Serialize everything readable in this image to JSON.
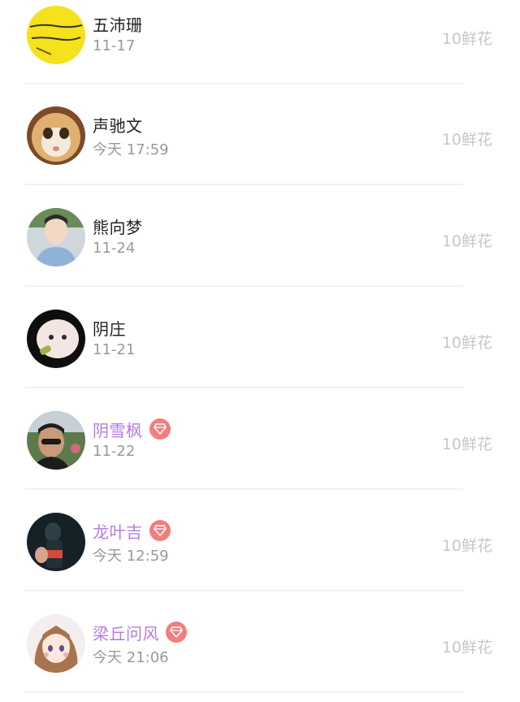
{
  "gift_rows": [
    {
      "name": "五沛珊",
      "time": "11-17",
      "gift": "10鲜花",
      "vip": false,
      "avatar": "yellow-sign-avatar"
    },
    {
      "name": "声驰文",
      "time": "今天 17:59",
      "gift": "10鲜花",
      "vip": false,
      "avatar": "cat-avatar"
    },
    {
      "name": "熊向梦",
      "time": "11-24",
      "gift": "10鲜花",
      "vip": false,
      "avatar": "portrait-avatar"
    },
    {
      "name": "阴庄",
      "time": "11-21",
      "gift": "10鲜花",
      "vip": false,
      "avatar": "white-cat-avatar"
    },
    {
      "name": "阴雪枫",
      "time": "11-22",
      "gift": "10鲜花",
      "vip": true,
      "avatar": "man-sunglasses-avatar"
    },
    {
      "name": "龙叶吉",
      "time": "今天 12:59",
      "gift": "10鲜花",
      "vip": true,
      "avatar": "dark-bottle-avatar"
    },
    {
      "name": "梁丘问风",
      "time": "今天 21:06",
      "gift": "10鲜花",
      "vip": true,
      "avatar": "anime-girl-avatar"
    }
  ],
  "colors": {
    "vip_name": "#b57be0",
    "vip_badge": "#f47d7d",
    "name": "#222222",
    "time": "#999999",
    "gift": "#c7c7c7"
  },
  "icons": {
    "vip_badge": "diamond-icon"
  }
}
